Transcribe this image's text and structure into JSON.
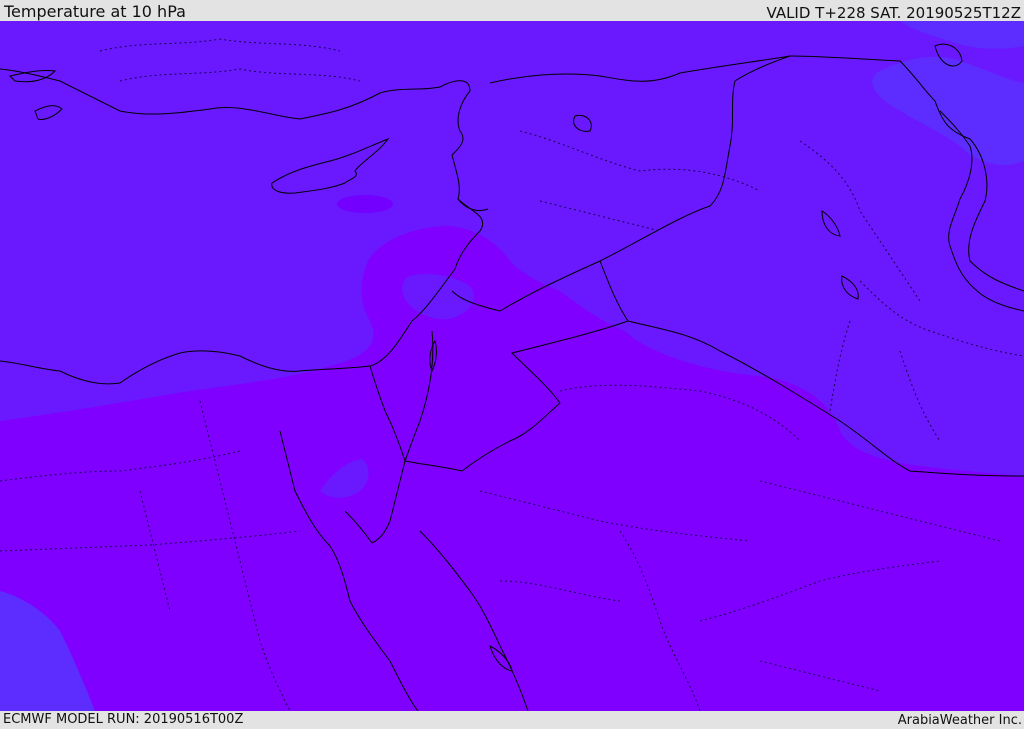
{
  "header": {
    "title": "Temperature at 10 hPa",
    "valid": "VALID T+228 SAT. 20190525T12Z"
  },
  "footer": {
    "model_run": "ECMWF MODEL RUN: 20190516T00Z",
    "credit": "ArabiaWeather Inc."
  },
  "map": {
    "colors": {
      "cold_band": "#6a19ff",
      "warm_band": "#7f00ff",
      "coolest_band": "#5d2cff",
      "border": "#000000"
    }
  }
}
